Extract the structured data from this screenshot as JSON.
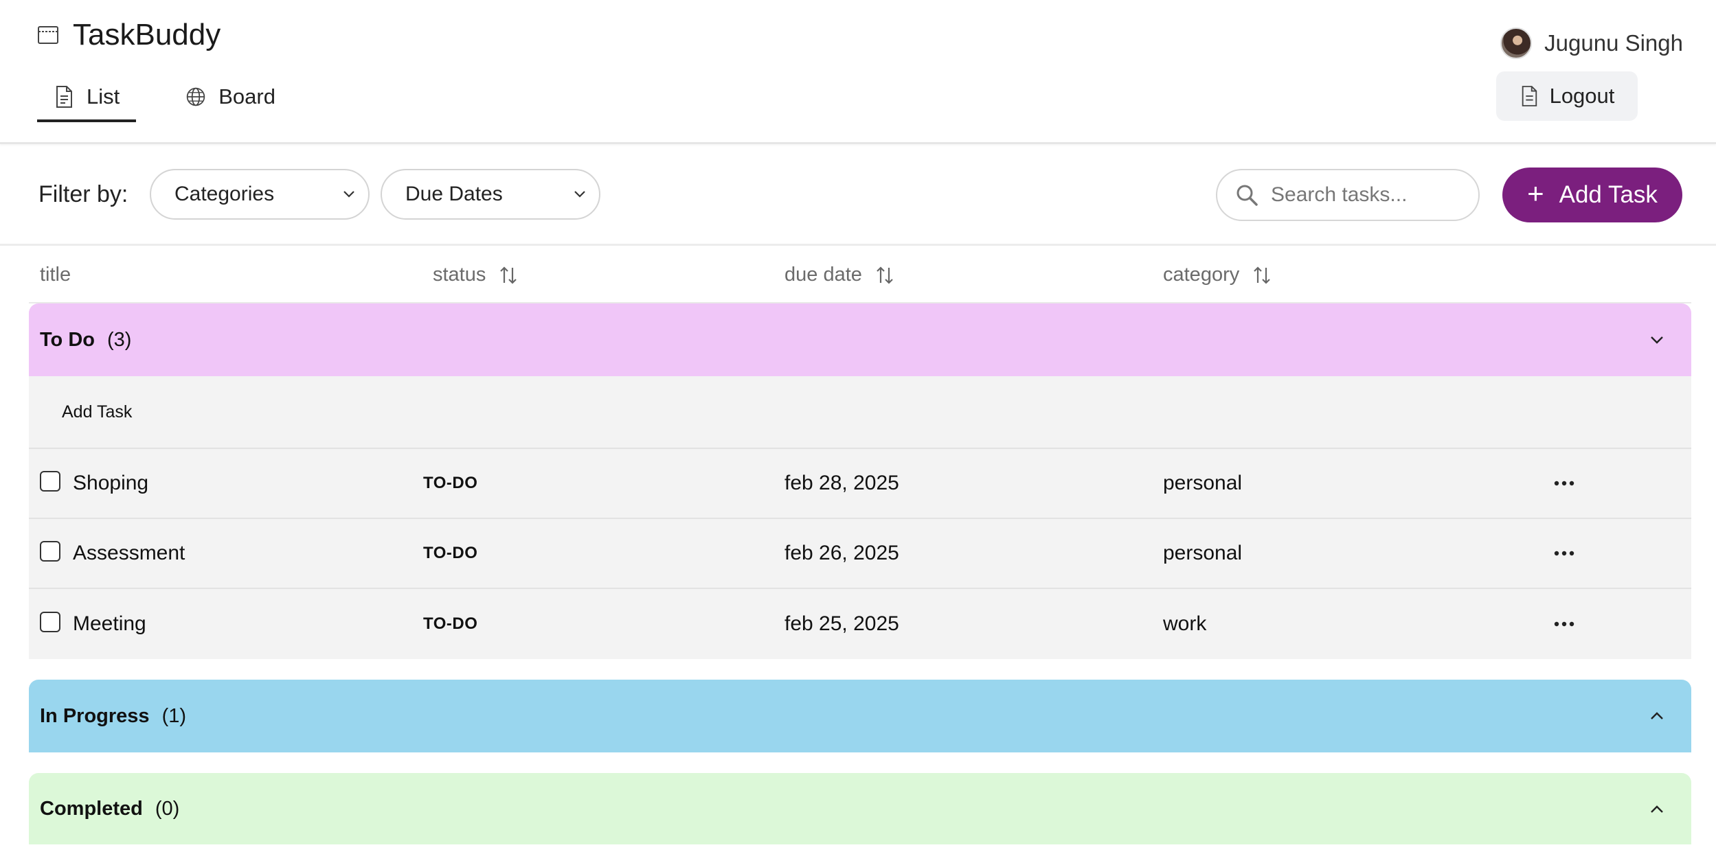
{
  "app": {
    "title": "TaskBuddy"
  },
  "tabs": [
    {
      "label": "List",
      "icon": "document-icon",
      "active": true
    },
    {
      "label": "Board",
      "icon": "globe-icon",
      "active": false
    }
  ],
  "user": {
    "name": "Jugunu Singh",
    "logout_label": "Logout"
  },
  "filters": {
    "label": "Filter by:",
    "categories": "Categories",
    "due_dates": "Due Dates"
  },
  "search": {
    "placeholder": "Search tasks..."
  },
  "add_task_label": "Add Task",
  "columns": {
    "title": "title",
    "status": "status",
    "due_date": "due date",
    "category": "category"
  },
  "sections": {
    "todo": {
      "name": "To Do",
      "count": "(3)",
      "color": "#f0c6f8",
      "add_label": "Add Task",
      "tasks": [
        {
          "title": "Shoping",
          "status": "TO-DO",
          "due": "feb 28, 2025",
          "category": "personal"
        },
        {
          "title": "Assessment",
          "status": "TO-DO",
          "due": "feb 26, 2025",
          "category": "personal"
        },
        {
          "title": "Meeting",
          "status": "TO-DO",
          "due": "feb 25, 2025",
          "category": "work"
        }
      ]
    },
    "in_progress": {
      "name": "In Progress",
      "count": "(1)",
      "color": "#99d6ee"
    },
    "completed": {
      "name": "Completed",
      "count": "(0)",
      "color": "#dcf8d8"
    }
  },
  "colors": {
    "accent": "#7b1f7e"
  }
}
